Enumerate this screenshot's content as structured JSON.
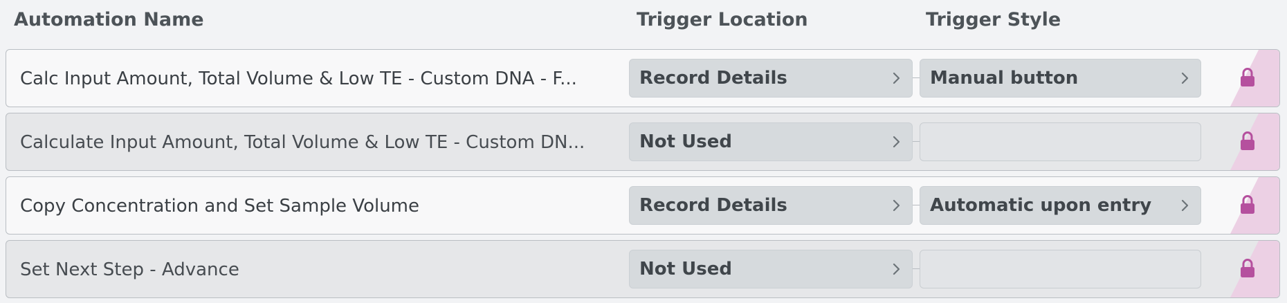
{
  "header": {
    "name_label": "Automation Name",
    "location_label": "Trigger Location",
    "style_label": "Trigger Style"
  },
  "colors": {
    "lock": "#b5509e",
    "lock_stripe": "#ecd0e4"
  },
  "rows": [
    {
      "name": "Calc Input Amount, Total Volume & Low TE - Custom DNA - F...",
      "trigger_location": "Record Details",
      "trigger_style": "Manual button",
      "state": "active",
      "icon": "lock-icon"
    },
    {
      "name": "Calculate Input Amount, Total Volume & Low TE - Custom DN...",
      "trigger_location": "Not Used",
      "trigger_style": "",
      "state": "inactive",
      "icon": "lock-icon"
    },
    {
      "name": "Copy Concentration and Set Sample Volume",
      "trigger_location": "Record Details",
      "trigger_style": "Automatic upon entry",
      "state": "active",
      "icon": "lock-icon"
    },
    {
      "name": "Set Next Step - Advance",
      "trigger_location": "Not Used",
      "trigger_style": "",
      "state": "inactive",
      "icon": "lock-icon"
    }
  ]
}
